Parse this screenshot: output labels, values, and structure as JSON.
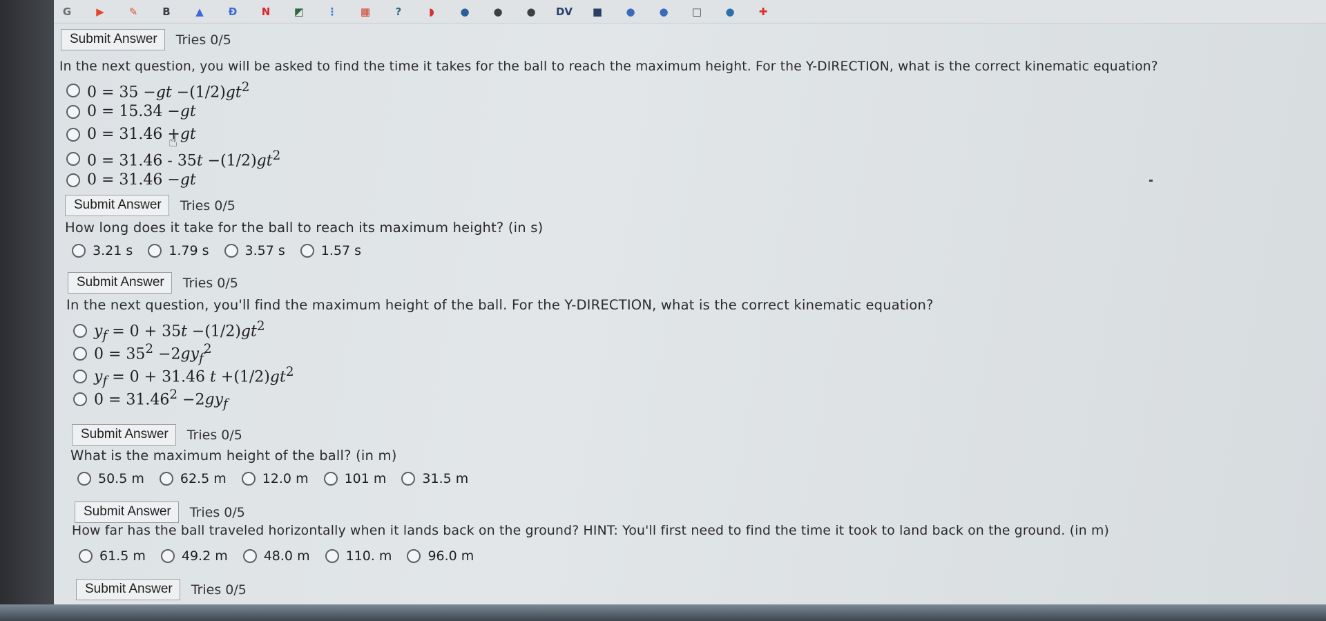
{
  "bookmarks": [
    {
      "label": "G",
      "color": "#6b6f74"
    },
    {
      "label": "▶",
      "color": "#e2472f"
    },
    {
      "label": "✎",
      "color": "#e0533c"
    },
    {
      "label": "B",
      "color": "#3b3f44"
    },
    {
      "label": "▲",
      "color": "#3d6ad6"
    },
    {
      "label": "Đ",
      "color": "#3d6ad6"
    },
    {
      "label": "N",
      "color": "#d7262b"
    },
    {
      "label": "◩",
      "color": "#2c6a3f"
    },
    {
      "label": "⋮",
      "color": "#2f7ad8"
    },
    {
      "label": "▦",
      "color": "#cf3a2a"
    },
    {
      "label": "?",
      "color": "#2f6f7a"
    },
    {
      "label": "◗",
      "color": "#d52f2f"
    },
    {
      "label": "●",
      "color": "#2b5f9a"
    },
    {
      "label": "●",
      "color": "#3f3f3f"
    },
    {
      "label": "●",
      "color": "#3f3f3f"
    },
    {
      "label": "DV",
      "color": "#2a3f6a"
    },
    {
      "label": "■",
      "color": "#2c3e62"
    },
    {
      "label": "●",
      "color": "#3c6ab8"
    },
    {
      "label": "●",
      "color": "#3c6ab8"
    },
    {
      "label": "□",
      "color": "#4a4a4a"
    },
    {
      "label": "●",
      "color": "#2e6fa9"
    },
    {
      "label": "✚",
      "color": "#d8342e"
    }
  ],
  "block0": {
    "submit_label": "Submit Answer",
    "tries": "Tries 0/5"
  },
  "q1": {
    "text": "In the next question, you will be asked to find the time it takes for the ball to reach the maximum height. For the Y-DIRECTION, what is the correct kinematic equation?",
    "options": [
      {
        "html": "0 = 35 −<i>gt</i> −(1/2)<i>gt</i><sup>2</sup>"
      },
      {
        "html": "0 = 15.34 −<i>gt</i>"
      },
      {
        "html": "0 = 31.46 +<i>gt</i>"
      },
      {
        "html": "0 = 31.46 - 35<i>t</i> −(1/2)<i>gt</i><sup>2</sup>"
      },
      {
        "html": "0 = 31.46 −<i>gt</i>"
      }
    ],
    "submit_label": "Submit Answer",
    "tries": "Tries 0/5"
  },
  "q2": {
    "text": "How long does it take for the ball to reach its maximum height? (in s)",
    "options": [
      "3.21 s",
      "1.79 s",
      "3.57 s",
      "1.57 s"
    ],
    "submit_label": "Submit Answer",
    "tries": "Tries 0/5"
  },
  "q3": {
    "text": "In the next question, you'll find the maximum height of the ball. For the Y-DIRECTION, what is the correct kinematic equation?",
    "options": [
      {
        "html": "<i>y<sub>f</sub></i> = 0 + 35<i>t</i> −(1/2)<i>gt</i><sup>2</sup>"
      },
      {
        "html": "0 = 35<sup>2</sup> −2<i>gy<sub>f</sub></i><sup>2</sup>"
      },
      {
        "html": "<i>y<sub>f</sub></i> = 0 + 31.46 <i>t</i> +(1/2)<i>gt</i><sup>2</sup>"
      },
      {
        "html": "0 = 31.46<sup>2</sup> −2<i>gy<sub>f</sub></i>"
      }
    ],
    "submit_label": "Submit Answer",
    "tries": "Tries 0/5"
  },
  "q4": {
    "text": "What is the maximum height of the ball? (in m)",
    "options": [
      "50.5 m",
      "62.5 m",
      "12.0 m",
      "101 m",
      "31.5 m"
    ],
    "submit_label": "Submit Answer",
    "tries": "Tries 0/5"
  },
  "q5": {
    "text": "How far has the ball traveled horizontally when it lands back on the ground? HINT: You'll first need to find the time it took to land back on the ground. (in m)",
    "options": [
      "61.5 m",
      "49.2 m",
      "48.0 m",
      "110. m",
      "96.0 m"
    ],
    "submit_label": "Submit Answer",
    "tries": "Tries 0/5"
  }
}
